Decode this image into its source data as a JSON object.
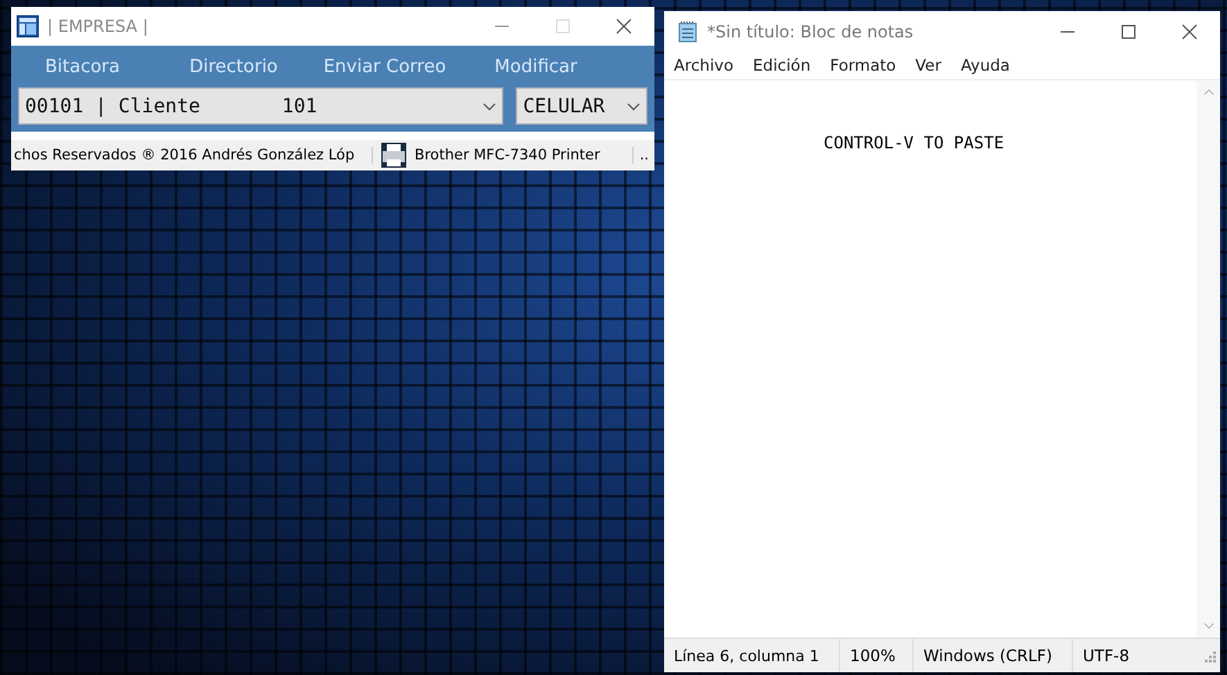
{
  "empresa_window": {
    "title": "| EMPRESA |",
    "toolbar": [
      {
        "label": "Bitacora"
      },
      {
        "label": "Directorio"
      },
      {
        "label": "Enviar Correo"
      },
      {
        "label": "Modificar"
      }
    ],
    "client_combo": {
      "value": "00101 | Cliente       101"
    },
    "phone_combo": {
      "value": "CELULAR"
    },
    "status_bar": {
      "copyright": "chos Reservados ® 2016 Andrés González Lóp",
      "printer": "Brother MFC-7340 Printer",
      "more": ".."
    }
  },
  "notepad_window": {
    "title": "*Sin título: Bloc de notas",
    "menu": [
      "Archivo",
      "Edición",
      "Formato",
      "Ver",
      "Ayuda"
    ],
    "text": "CONTROL-V TO PASTE",
    "status_bar": [
      "Línea 6, columna 1",
      "100%",
      "Windows (CRLF)",
      "UTF-8"
    ]
  }
}
